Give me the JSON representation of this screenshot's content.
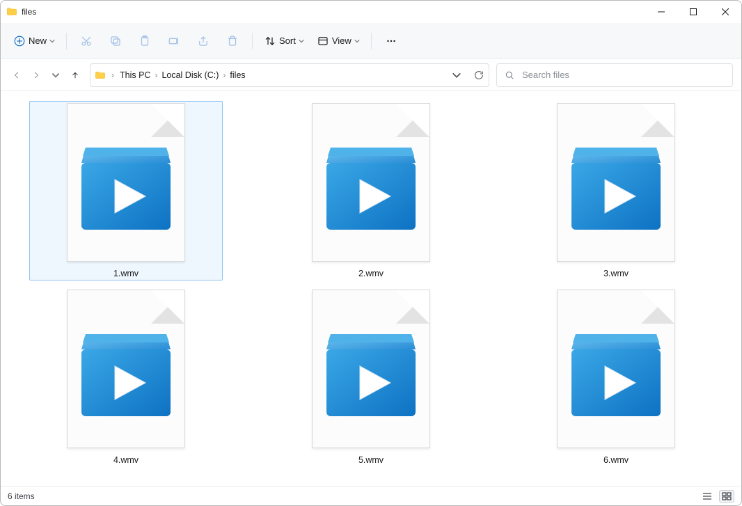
{
  "window": {
    "title": "files"
  },
  "toolbar": {
    "new_label": "New",
    "sort_label": "Sort",
    "view_label": "View"
  },
  "breadcrumbs": [
    "This PC",
    "Local Disk (C:)",
    "files"
  ],
  "search": {
    "placeholder": "Search files"
  },
  "files": [
    {
      "name": "1.wmv",
      "selected": true
    },
    {
      "name": "2.wmv",
      "selected": false
    },
    {
      "name": "3.wmv",
      "selected": false
    },
    {
      "name": "4.wmv",
      "selected": false
    },
    {
      "name": "5.wmv",
      "selected": false
    },
    {
      "name": "6.wmv",
      "selected": false
    }
  ],
  "status": {
    "items_text": "6 items"
  }
}
